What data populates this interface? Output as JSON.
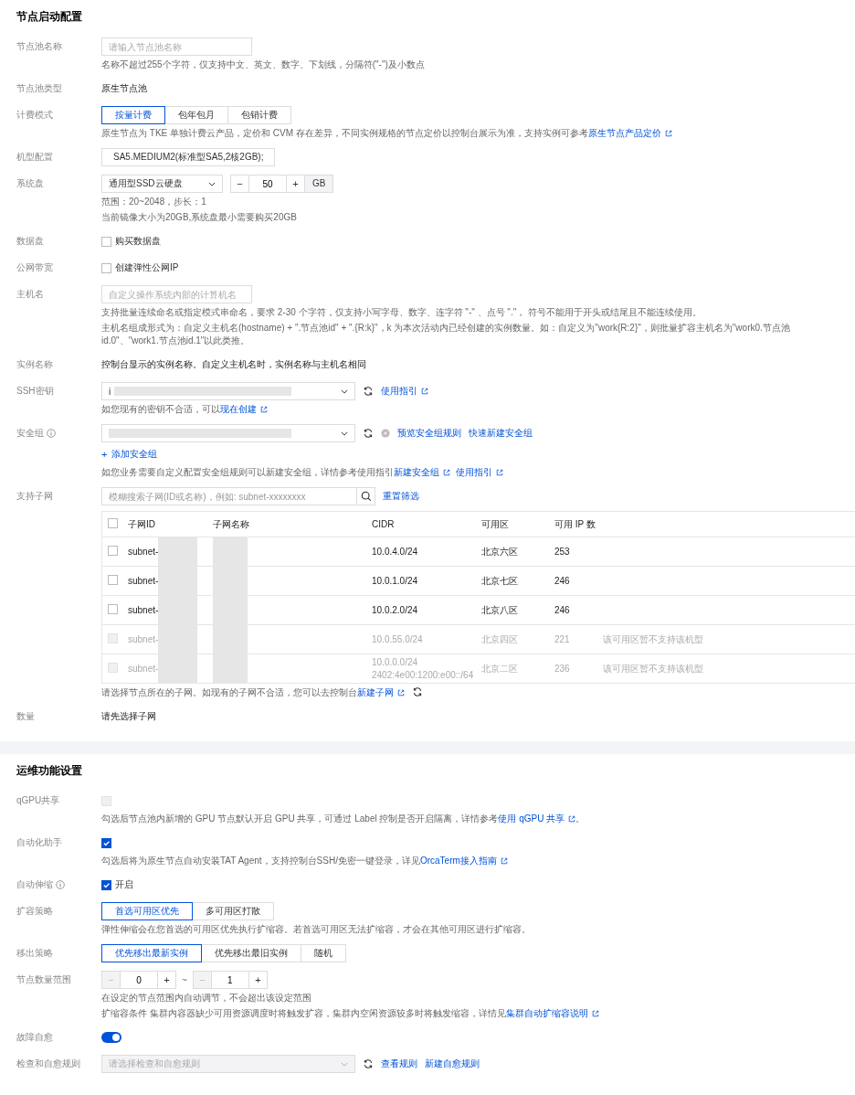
{
  "sections": [
    {
      "title": "节点启动配置",
      "rows": [
        {
          "label": "节点池名称",
          "items": [
            {
              "kind": "input",
              "placeholder": "请输入节点池名称"
            },
            {
              "kind": "hint",
              "text": "名称不超过255个字符，仅支持中文、英文、数字、下划线，分隔符(\"-\")及小数点"
            }
          ]
        },
        {
          "label": "节点池类型",
          "items": [
            {
              "kind": "value",
              "text": "原生节点池"
            }
          ]
        },
        {
          "label": "计费模式",
          "items": [
            {
              "kind": "segmented",
              "options": [
                {
                  "label": "按量计费",
                  "selected": true
                },
                {
                  "label": "包年包月",
                  "selected": false
                },
                {
                  "label": "包销计费",
                  "selected": false
                }
              ]
            },
            {
              "kind": "hint",
              "text": "原生节点为 TKE 单独计费云产品，定价和 CVM 存在差异，不同实例规格的节点定价以控制台展示为准，支持实例可参考",
              "links": [
                {
                  "text": "原生节点产品定价",
                  "ext": true
                }
              ]
            }
          ]
        },
        {
          "label": "机型配置",
          "items": [
            {
              "kind": "box",
              "text": "SA5.MEDIUM2(标准型SA5,2核2GB);"
            }
          ]
        },
        {
          "label": "系统盘",
          "items": [
            {
              "kind": "disk",
              "select": "通用型SSD云硬盘",
              "stepper": {
                "minus": "−",
                "value": "50",
                "plus": "+"
              },
              "unit": "GB"
            },
            {
              "kind": "hint",
              "text": "范围：20~2048，步长：1"
            },
            {
              "kind": "hint",
              "text": "当前镜像大小为20GB,系统盘最小需要购买20GB"
            }
          ]
        },
        {
          "label": "数据盘",
          "items": [
            {
              "kind": "checkbox",
              "label": "购买数据盘",
              "checked": false,
              "disabled": false
            }
          ]
        },
        {
          "label": "公网带宽",
          "items": [
            {
              "kind": "checkbox",
              "label": "创建弹性公网IP",
              "checked": false,
              "disabled": false
            }
          ]
        },
        {
          "label": "主机名",
          "items": [
            {
              "kind": "input",
              "placeholder": "自定义操作系统内部的计算机名"
            },
            {
              "kind": "hint",
              "text": "支持批量连续命名或指定模式串命名，要求 2-30 个字符，仅支持小写字母、数字、连字符 \"-\" 、点号 \".\"， 符号不能用于开头或结尾且不能连续使用。"
            },
            {
              "kind": "hint",
              "text": "主机名组成形式为：自定义主机名(hostname) + \".节点池id\" + \".{R:k}\"，k 为本次活动内已经创建的实例数量。如：自定义为\"work{R:2}\"，则批量扩容主机名为\"work0.节点池id.0\"、\"work1.节点池id.1\"以此类推。"
            }
          ]
        },
        {
          "label": "实例名称",
          "items": [
            {
              "kind": "value",
              "text": "控制台显示的实例名称。自定义主机名时，实例名称与主机名相同"
            }
          ]
        },
        {
          "label": "SSH密钥",
          "items": [
            {
              "kind": "select",
              "value": "i",
              "redacted": true,
              "refresh": true,
              "links": [
                {
                  "text": "使用指引",
                  "ext": true
                }
              ]
            },
            {
              "kind": "hint",
              "text": "如您现有的密钥不合适，可以",
              "links": [
                {
                  "text": "现在创建",
                  "ext": true
                }
              ]
            }
          ]
        },
        {
          "label": "安全组",
          "info": true,
          "items": [
            {
              "kind": "select",
              "redacted": true,
              "refresh": true,
              "clear": true,
              "links": [
                {
                  "text": "预览安全组规则"
                },
                {
                  "text": "快速新建安全组"
                }
              ]
            },
            {
              "kind": "add",
              "icon": "+",
              "text": "添加安全组"
            },
            {
              "kind": "hint",
              "text": "如您业务需要自定义配置安全组规则可以新建安全组，详情参考使用指引",
              "links": [
                {
                  "text": "新建安全组",
                  "ext": true
                },
                {
                  "text": "使用指引",
                  "ext": true
                }
              ]
            }
          ]
        },
        {
          "label": "支持子网",
          "items": [
            {
              "kind": "search",
              "placeholder": "模糊搜索子网(ID或名称)，例如: subnet-xxxxxxxx",
              "link": "重置筛选"
            },
            {
              "kind": "table",
              "all_checked": false,
              "columns": [
                "子网ID",
                "子网名称",
                "CIDR",
                "可用区",
                "可用 IP 数"
              ],
              "rows": [
                {
                  "id": "subnet-",
                  "redacted": true,
                  "cidr": [
                    "10.0.4.0/24"
                  ],
                  "zone": "北京六区",
                  "ips": "253",
                  "checked": false,
                  "disabled": false
                },
                {
                  "id": "subnet-",
                  "redacted": true,
                  "cidr": [
                    "10.0.1.0/24"
                  ],
                  "zone": "北京七区",
                  "ips": "246",
                  "checked": false,
                  "disabled": false
                },
                {
                  "id": "subnet-",
                  "redacted": true,
                  "cidr": [
                    "10.0.2.0/24"
                  ],
                  "zone": "北京八区",
                  "ips": "246",
                  "checked": false,
                  "disabled": false
                },
                {
                  "id": "subnet-",
                  "redacted": true,
                  "cidr": [
                    "10.0.55.0/24"
                  ],
                  "zone": "北京四区",
                  "ips": "221",
                  "note": "该可用区暂不支持该机型",
                  "checked": false,
                  "disabled": true
                },
                {
                  "id": "subnet-",
                  "redacted": true,
                  "cidr": [
                    "10.0.0.0/24",
                    "2402:4e00:1200:e00::/64"
                  ],
                  "zone": "北京二区",
                  "ips": "236",
                  "note": "该可用区暂不支持该机型",
                  "checked": false,
                  "disabled": true
                }
              ]
            },
            {
              "kind": "hint",
              "text": "请选择节点所在的子网。如现有的子网不合适，您可以去控制台",
              "links": [
                {
                  "text": "新建子网",
                  "ext": true
                }
              ],
              "refresh": true
            }
          ]
        },
        {
          "label": "数量",
          "items": [
            {
              "kind": "value",
              "text": "请先选择子网"
            }
          ]
        }
      ]
    },
    {
      "title": "运维功能设置",
      "rows": [
        {
          "label": "qGPU共享",
          "items": [
            {
              "kind": "checkbox",
              "checked": false,
              "disabled": true
            },
            {
              "kind": "hint",
              "text": "勾选后节点池内新增的 GPU 节点默认开启 GPU 共享，可通过 Label 控制是否开启隔离，详情参考",
              "links": [
                {
                  "text": "使用 qGPU 共享",
                  "ext": true
                }
              ],
              "after": "。"
            }
          ]
        },
        {
          "label": "自动化助手",
          "items": [
            {
              "kind": "checkbox",
              "checked": true,
              "disabled": false
            },
            {
              "kind": "hint",
              "text": "勾选后将为原生节点自动安装TAT Agent，支持控制台SSH/免密一键登录，详见",
              "links": [
                {
                  "text": "OrcaTerm接入指南",
                  "ext": true
                }
              ]
            }
          ]
        },
        {
          "label": "自动伸缩",
          "info": true,
          "items": [
            {
              "kind": "checkbox",
              "label": "开启",
              "checked": true,
              "disabled": false
            }
          ]
        },
        {
          "label": "扩容策略",
          "items": [
            {
              "kind": "segmented",
              "options": [
                {
                  "label": "首选可用区优先",
                  "selected": true
                },
                {
                  "label": "多可用区打散",
                  "selected": false
                }
              ]
            },
            {
              "kind": "hint",
              "text": "弹性伸缩会在您首选的可用区优先执行扩缩容。若首选可用区无法扩缩容，才会在其他可用区进行扩缩容。"
            }
          ]
        },
        {
          "label": "移出策略",
          "items": [
            {
              "kind": "segmented",
              "options": [
                {
                  "label": "优先移出最新实例",
                  "selected": true
                },
                {
                  "label": "优先移出最旧实例",
                  "selected": false
                },
                {
                  "label": "随机",
                  "selected": false
                }
              ]
            }
          ]
        },
        {
          "label": "节点数量范围",
          "items": [
            {
              "kind": "range",
              "min": {
                "minus": "−",
                "value": "0",
                "plus": "+",
                "minus_disabled": true
              },
              "sep": "~",
              "max": {
                "minus": "−",
                "value": "1",
                "plus": "+",
                "minus_disabled": true
              }
            },
            {
              "kind": "hint",
              "text": "在设定的节点范围内自动调节，不会超出该设定范围"
            },
            {
              "kind": "hint",
              "text": "扩缩容条件 集群内容器缺少可用资源调度时将触发扩容，集群内空闲资源较多时将触发缩容，详情见",
              "links": [
                {
                  "text": "集群自动扩缩容说明",
                  "ext": true
                }
              ]
            }
          ]
        },
        {
          "label": "故障自愈",
          "items": [
            {
              "kind": "toggle",
              "on": true
            }
          ]
        },
        {
          "label": "检查和自愈规则",
          "items": [
            {
              "kind": "select",
              "placeholder": "请选择检查和自愈规则",
              "disabled": true,
              "refresh": true,
              "links": [
                {
                  "text": "查看规则"
                },
                {
                  "text": "新建自愈规则"
                }
              ]
            }
          ]
        }
      ]
    }
  ]
}
